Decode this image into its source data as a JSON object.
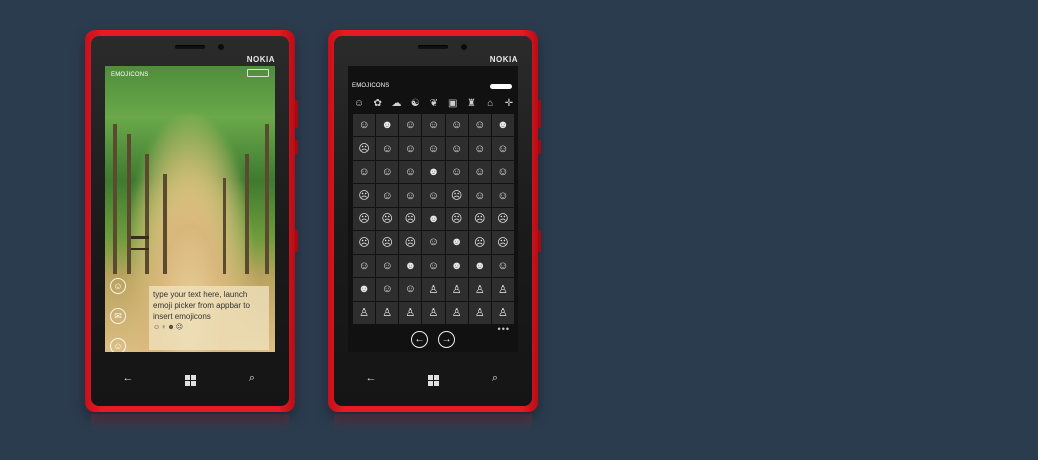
{
  "phone_left": {
    "brand": "NOKIA",
    "app_title": "EMOJICONS",
    "textbox_text": "type your text here, launch emoji picker from appbar to insert emojicons",
    "inline_emojis": "☺♀☻☹",
    "appbar": [
      {
        "icon": "emoji-icon",
        "glyph": "☺"
      },
      {
        "icon": "chat-icon",
        "glyph": "✉"
      },
      {
        "icon": "smiley-icon",
        "glyph": "☺"
      }
    ],
    "nav": {
      "back": "←",
      "search": "⌕"
    }
  },
  "phone_right": {
    "brand": "NOKIA",
    "app_title": "EMOJICONS",
    "categories": [
      {
        "icon": "smiley-category-icon",
        "glyph": "☺"
      },
      {
        "icon": "flower-category-icon",
        "glyph": "✿"
      },
      {
        "icon": "animal-category-icon",
        "glyph": "☁"
      },
      {
        "icon": "food-category-icon",
        "glyph": "☯"
      },
      {
        "icon": "leaf-category-icon",
        "glyph": "❦"
      },
      {
        "icon": "gift-category-icon",
        "glyph": "▣"
      },
      {
        "icon": "bag-category-icon",
        "glyph": "♜"
      },
      {
        "icon": "house-category-icon",
        "glyph": "⌂"
      },
      {
        "icon": "symbol-category-icon",
        "glyph": "✛"
      }
    ],
    "emoji_grid": [
      "☺",
      "☻",
      "☺",
      "☺",
      "☺",
      "☺",
      "☻",
      "☹",
      "☺",
      "☺",
      "☺",
      "☺",
      "☺",
      "☺",
      "☺",
      "☺",
      "☺",
      "☻",
      "☺",
      "☺",
      "☺",
      "☹",
      "☺",
      "☺",
      "☺",
      "☹",
      "☺",
      "☺",
      "☹",
      "☹",
      "☹",
      "☻",
      "☹",
      "☹",
      "☹",
      "☹",
      "☹",
      "☹",
      "☺",
      "☻",
      "☹",
      "☹",
      "☺",
      "☺",
      "☻",
      "☺",
      "☻",
      "☻",
      "☺",
      "☻",
      "☺",
      "☺",
      "♙",
      "♙",
      "♙",
      "♙",
      "♙",
      "♙",
      "♙",
      "♙",
      "♙",
      "♙",
      "♙"
    ],
    "footer": {
      "prev": "←",
      "next": "→",
      "more": "•••"
    },
    "nav": {
      "back": "←",
      "search": "⌕"
    }
  }
}
